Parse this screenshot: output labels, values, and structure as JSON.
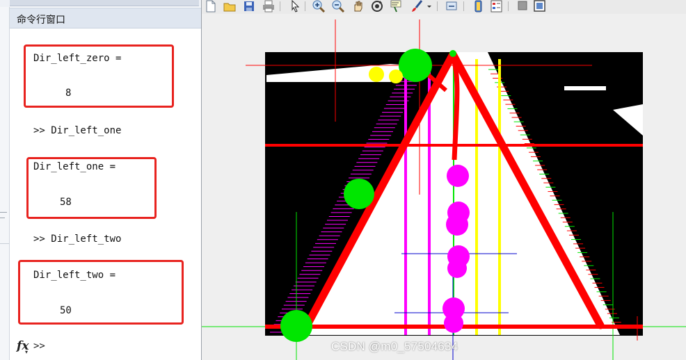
{
  "command_window": {
    "title": "命令行窗口",
    "entries": [
      {
        "assign": "Dir_left_zero =",
        "value": "8"
      },
      {
        "command": ">> Dir_left_one"
      },
      {
        "assign": "Dir_left_one =",
        "value": "58"
      },
      {
        "command": ">> Dir_left_two"
      },
      {
        "assign": "Dir_left_two =",
        "value": "50"
      }
    ],
    "prompt": ">>",
    "fx_icon": "fx-icon",
    "highlight_color": "#e8231f"
  },
  "figure": {
    "toolbar_icons": [
      "new-figure-icon",
      "open-file-icon",
      "save-icon",
      "print-icon",
      "pointer-icon",
      "zoom-in-icon",
      "zoom-out-icon",
      "pan-icon",
      "rotate-icon",
      "data-cursor-icon",
      "brush-icon",
      "link-plot-icon",
      "colorbar-icon",
      "legend-icon",
      "hide-tools-icon",
      "dock-icon"
    ],
    "colors": {
      "background": "#000000",
      "road": "#ffffff",
      "red_lines": "#ff0000",
      "green_marks": "#00e600",
      "magenta_marks": "#ff00ff",
      "yellow_lines": "#ffff00",
      "blue_lines": "#0000cc"
    }
  },
  "watermark": "CSDN @m0_57504634"
}
